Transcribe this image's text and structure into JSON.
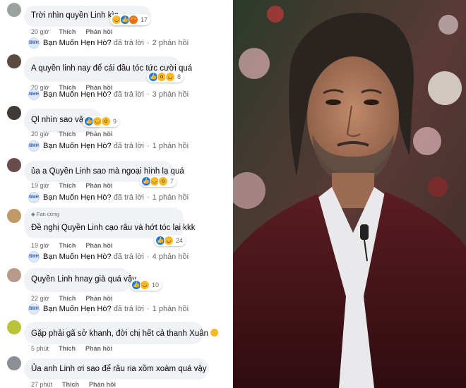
{
  "comments": [
    {
      "text": "Trời nhìn quyền Linh kìa",
      "reactions": [
        "haha",
        "like",
        "angry"
      ],
      "count": "17",
      "time": "20 giờ",
      "like": "Thích",
      "reply": "Phản hồi",
      "replier": "Bạn Muốn Hẹn Hò?",
      "replied": "đã trả lời",
      "replies": "2 phản hồi"
    },
    {
      "text": "A quyền linh nay để cái đầu tóc tức cười quá",
      "reactions": [
        "like",
        "wow",
        "haha"
      ],
      "count": "8",
      "time": "20 giờ",
      "like": "Thích",
      "reply": "Phản hồi",
      "replier": "Bạn Muốn Hẹn Hò?",
      "replied": "đã trả lời",
      "replies": "3 phản hồi"
    },
    {
      "text": "Ql nhìn sao vậy",
      "reactions": [
        "like",
        "haha",
        "wow"
      ],
      "count": "9",
      "time": "20 giờ",
      "like": "Thích",
      "reply": "Phản hồi",
      "replier": "Bạn Muốn Hẹn Hò?",
      "replied": "đã trả lời",
      "replies": "1 phản hồi"
    },
    {
      "text": "ủa a Quyền Linh sao mà ngoại hình lạ quá",
      "reactions": [
        "like",
        "haha",
        "wow"
      ],
      "count": "7",
      "time": "19 giờ",
      "like": "Thích",
      "reply": "Phản hồi",
      "replier": "Bạn Muốn Hẹn Hò?",
      "replied": "đã trả lời",
      "replies": "1 phản hồi"
    },
    {
      "fan_label": "Fan cứng",
      "text": "Đề nghị Quyền Linh cạo râu và hớt tóc lại kkk",
      "reactions": [
        "like",
        "haha"
      ],
      "count": "24",
      "time": "19 giờ",
      "like": "Thích",
      "reply": "Phản hồi",
      "replier": "Bạn Muốn Hẹn Hò?",
      "replied": "đã trả lời",
      "replies": "4 phản hồi"
    },
    {
      "text": "Quyền Linh hnay già quá vậy.",
      "reactions": [
        "like",
        "haha"
      ],
      "count": "10",
      "time": "22 giờ",
      "like": "Thích",
      "reply": "Phản hồi",
      "replier": "Bạn Muốn Hẹn Hò?",
      "replied": "đã trả lời",
      "replies": "1 phản hồi"
    },
    {
      "text": "Gặp phải gã sở khanh, đời chị hết cả thanh Xuân",
      "time": "5 phút",
      "like": "Thích",
      "reply": "Phản hồi"
    },
    {
      "text": "Ủa anh Linh ơi sao để râu ria xồm xoàm quá vậy",
      "time": "27 phút",
      "like": "Thích",
      "reply": "Phản hồi"
    }
  ],
  "colors": {
    "bubble": "#f0f2f5",
    "like": "#1877f2",
    "haha": "#f7b928",
    "angry": "#e9710f",
    "meta": "#65676b"
  }
}
